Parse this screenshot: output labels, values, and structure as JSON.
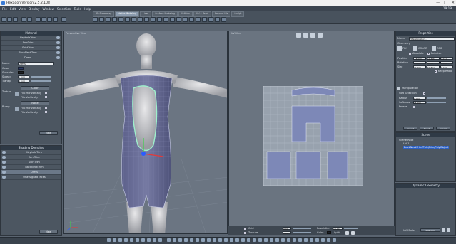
{
  "window": {
    "title": "Hexagon Version 2.5.2.108",
    "controls": [
      "—",
      "□",
      "✕"
    ]
  },
  "menu": [
    "File",
    "Edit",
    "View",
    "Display",
    "Window",
    "Selection",
    "Tools",
    "Help"
  ],
  "clock": "19:19",
  "tabs": [
    {
      "label": "3D Streetmap",
      "active": false
    },
    {
      "label": "Vertex Modeling",
      "active": true
    },
    {
      "label": "Lines",
      "active": false
    },
    {
      "label": "Surface Modeling",
      "active": false
    },
    {
      "label": "Utilities",
      "active": false
    },
    {
      "label": "UV & Paint",
      "active": false
    },
    {
      "label": "Second Life",
      "active": false
    },
    {
      "label": "Sculpt",
      "active": false
    }
  ],
  "left_top_panel": {
    "header": "Material",
    "items": [
      "KeyholeTrim",
      "ArmTrim",
      "SkirtTrim",
      "BackNeckTrim",
      "Dress"
    ],
    "props": {
      "name_label": "Name",
      "name_value": "Dress",
      "color_label": "Color",
      "specular_label": "Specular",
      "spread_label": "Spread",
      "spread_value": "1.000",
      "transp_label": "Transp",
      "transp_value": "0.000",
      "texture_label": "Texture",
      "texture_value": "Color",
      "flip_h": "Flip Horizontally",
      "flip_v": "Flip Vertically",
      "bump_label": "Bump",
      "bump_value": "None",
      "flip_h2": "Flip Horizontally",
      "flip_v2": "Flip Vertically",
      "new_button": "New"
    }
  },
  "left_bottom_panel": {
    "header": "Shading Domains",
    "items": [
      "KeyholeTrim",
      "ArmTrim",
      "SkirtTrim",
      "BackNeckTrim",
      "Dress",
      "Unassigned faces"
    ],
    "new_button": "New"
  },
  "viewport_3d": {
    "label": "Perspective View"
  },
  "viewport_2d": {
    "label": "UV View"
  },
  "uv_bottom": {
    "grid_label": "Grid",
    "grid_value": "0.00",
    "texture_label": "Texture",
    "texture_value": "0.00",
    "resolution_label": "Resolution",
    "resolution_value": "10.00",
    "color_label": "Color",
    "split_label": "Split"
  },
  "properties": {
    "header": "Properties",
    "name_label": "Name",
    "name_value": "FbTailsNoseFurs...",
    "geometry_label": "Geometry",
    "tabs": [
      "FIX",
      "COLOR",
      "ONE"
    ],
    "absolute_label": "Absolute",
    "relative_label": "Relative",
    "position_label": "Position",
    "position": [
      "-15.000",
      "12.345",
      "4.912"
    ],
    "rotation_label": "Rotation",
    "rotation": [
      "0.000",
      "0.000",
      "0.000"
    ],
    "size_label": "Size",
    "size": [
      "13.269",
      "59.862",
      "9.150"
    ],
    "keep_ratio": "Keep Ratio",
    "manipulation_label": "Manipulation",
    "soft_selection_label": "Soft Selection",
    "radius_label": "Radius",
    "radius_value": "1.000",
    "softness_label": "Softness",
    "softness_value": "75.000",
    "freeze_label": "Freeze",
    "buttons": [
      "Accept",
      "Reset",
      "Cancel"
    ]
  },
  "scene": {
    "header": "Scene",
    "tree": [
      "Scene Root",
      "UV 1",
      "BackNeckTrim/Pole/Rim/PolyObject"
    ],
    "buttons": [
      "",
      "",
      ""
    ]
  },
  "dynamic_geometry": {
    "header": "Dynamic Geometry",
    "uv_model": "UV Model",
    "dropdown": "Selection"
  }
}
